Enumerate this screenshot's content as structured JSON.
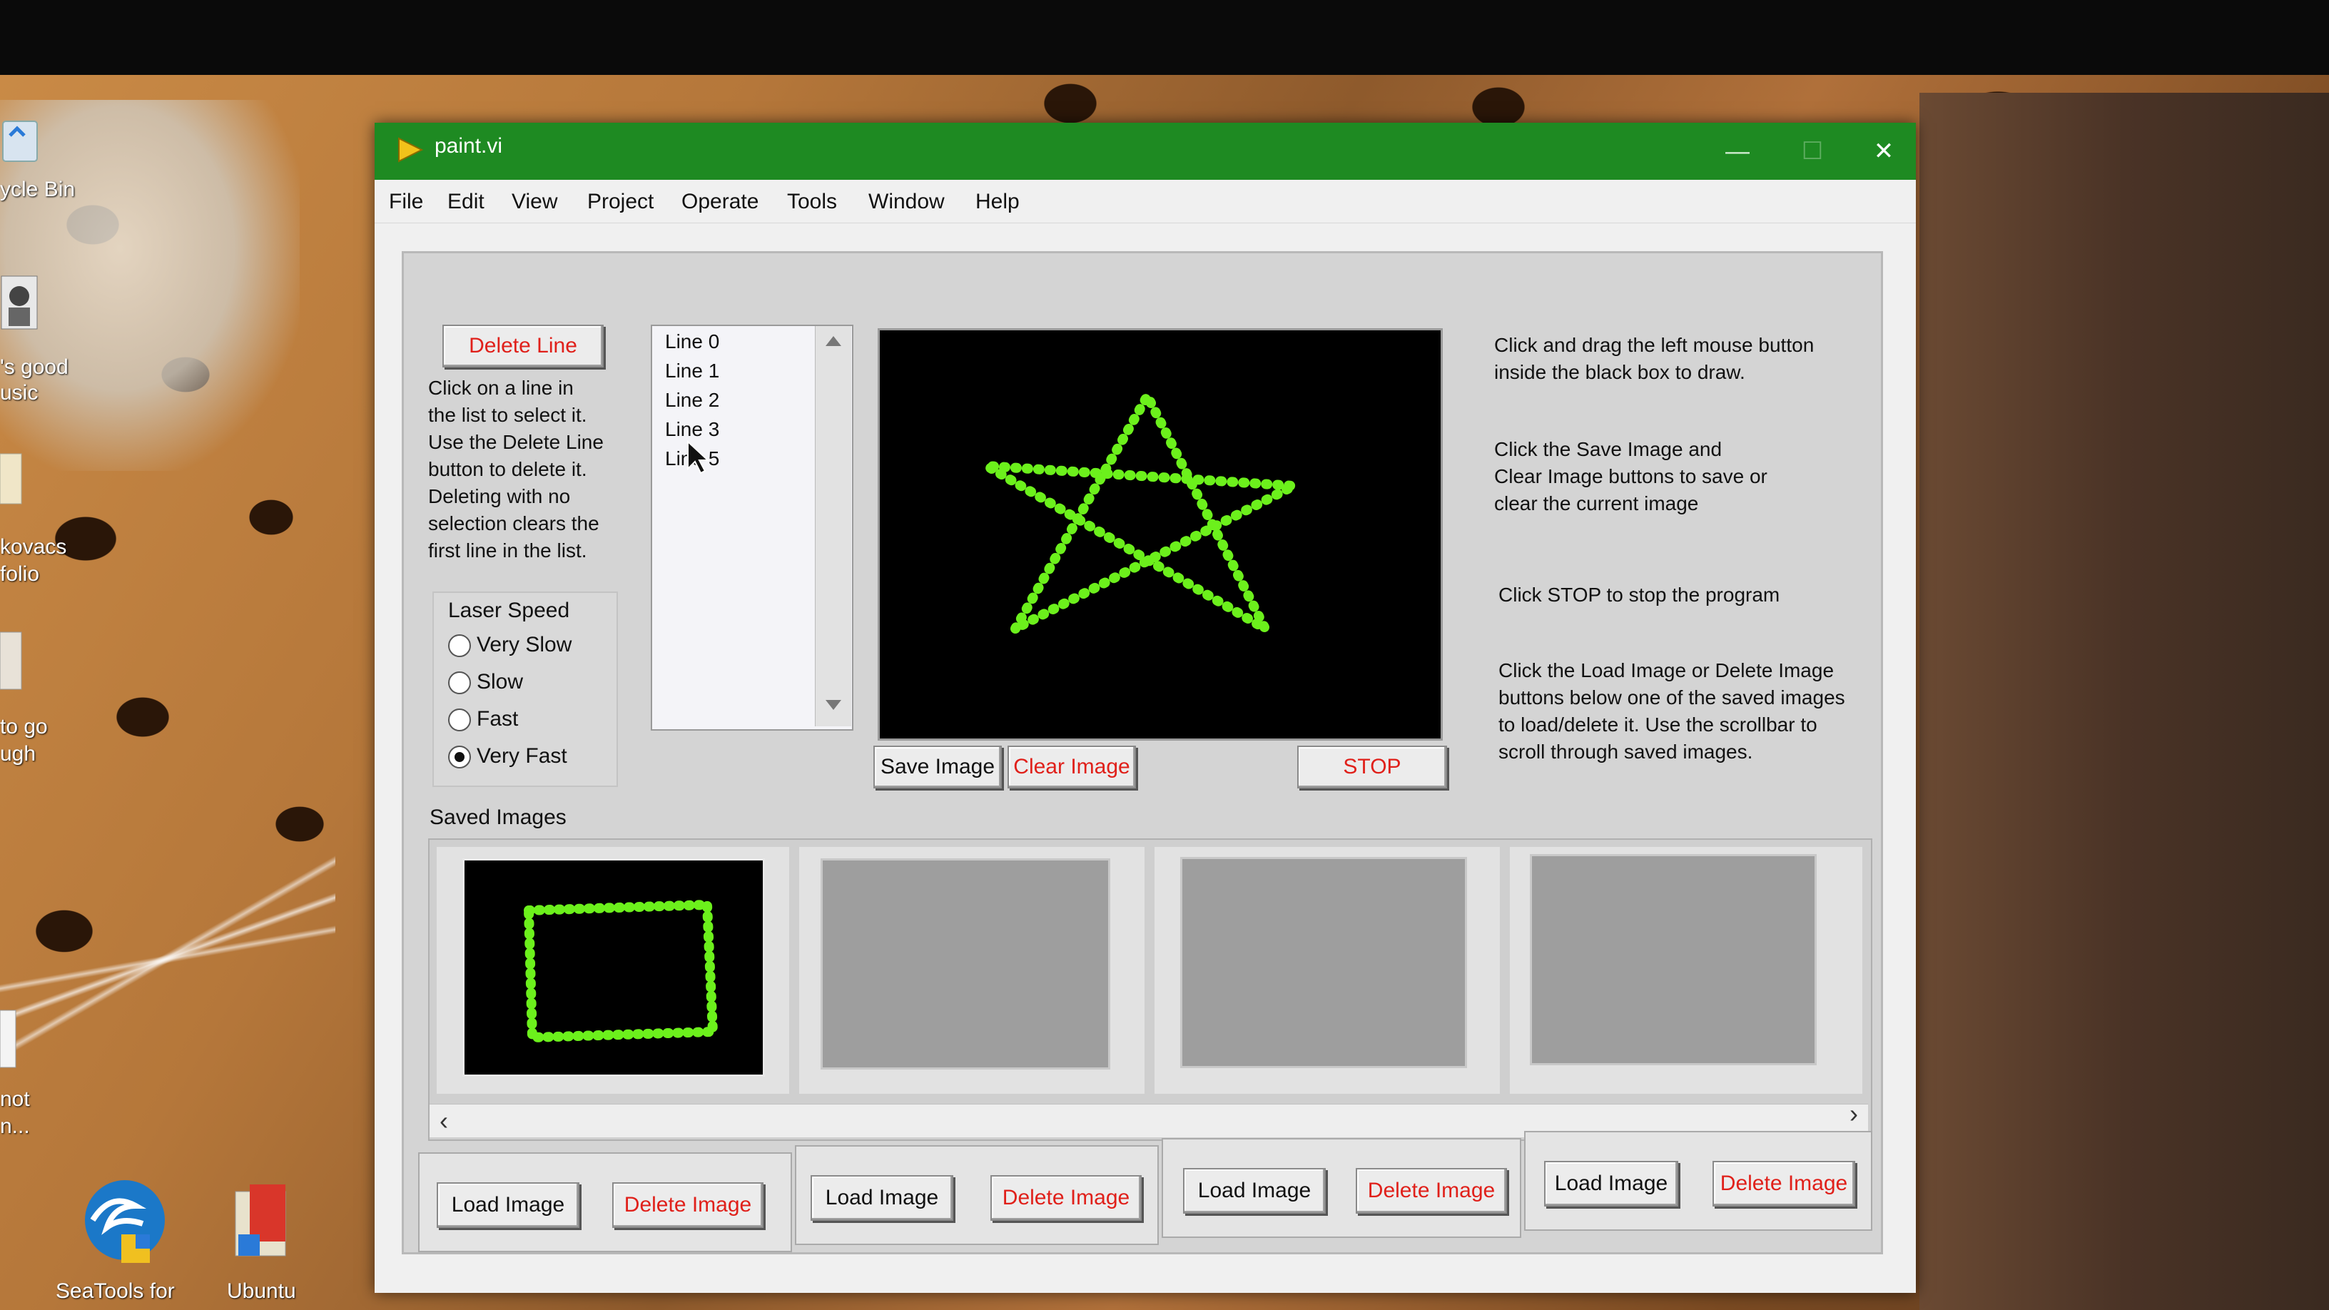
{
  "desktop": {
    "icons": [
      {
        "label": "ycle Bin",
        "icon": "recycle-bin-icon"
      },
      {
        "label": "'s good\nusic",
        "icon": "person-icon"
      },
      {
        "label": "kovacs\nfolio",
        "icon": "folder-icon"
      },
      {
        "label": "to go\nugh",
        "icon": "document-icon"
      },
      {
        "label": "not\nn...",
        "icon": "document-icon"
      },
      {
        "label": "SeaTools for",
        "icon": "seatools-icon"
      },
      {
        "label": "Ubuntu",
        "icon": "ubuntu-folder-icon"
      }
    ]
  },
  "window": {
    "title": "paint.vi",
    "title_color": "#1e8a22",
    "controls": {
      "minimize": "—",
      "maximize": "☐",
      "close": "✕"
    }
  },
  "menu": [
    "File",
    "Edit",
    "View",
    "Project",
    "Operate",
    "Tools",
    "Window",
    "Help"
  ],
  "panel": {
    "delete_line_label": "Delete Line",
    "delete_line_note": [
      "Click on a line in",
      "the list to select it.",
      "Use the Delete Line",
      "button to delete it.",
      "Deleting with no",
      "selection clears the",
      "first line in the list."
    ],
    "lines": [
      "Line 0",
      "Line 1",
      "Line 2",
      "Line 3",
      "Line 5"
    ],
    "laser_speed": {
      "title": "Laser Speed",
      "options": [
        "Very Slow",
        "Slow",
        "Fast",
        "Very Fast"
      ],
      "selected": "Very Fast"
    },
    "drawing": {
      "stroke_color": "#6cf01c",
      "shape": "star"
    },
    "save_image_label": "Save Image",
    "clear_image_label": "Clear Image",
    "stop_label": "STOP",
    "instructions": [
      [
        "Click and drag the left mouse button",
        "inside the black box to draw."
      ],
      [
        "Click the Save Image and",
        "Clear Image buttons to save or",
        "clear the current image"
      ],
      [
        "Click STOP to stop the program"
      ],
      [
        "Click the Load Image or Delete Image",
        "buttons below one of the saved images",
        "to load/delete it. Use the scrollbar to",
        "scroll through saved images."
      ]
    ],
    "saved_images_label": "Saved Images",
    "saved_images": [
      {
        "state": "saved",
        "shape": "rectangle"
      },
      {
        "state": "empty"
      },
      {
        "state": "empty"
      },
      {
        "state": "empty"
      }
    ],
    "load_image_label": "Load Image",
    "delete_image_label": "Delete Image",
    "scroll_left": "‹",
    "scroll_right": "›"
  }
}
